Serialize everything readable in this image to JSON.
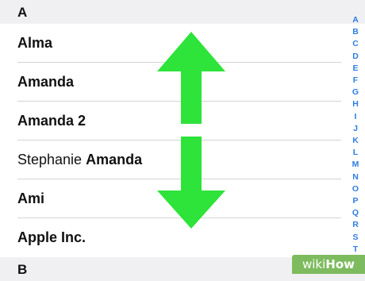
{
  "sections": {
    "a": "A",
    "b": "B"
  },
  "contacts": [
    {
      "first": "",
      "last": "Alma"
    },
    {
      "first": "",
      "last": "Amanda"
    },
    {
      "first": "",
      "last": "Amanda 2"
    },
    {
      "first": "Stephanie ",
      "last": "Amanda"
    },
    {
      "first": "",
      "last": "Ami"
    },
    {
      "first": "",
      "last": "Apple Inc."
    }
  ],
  "index": [
    "A",
    "B",
    "C",
    "D",
    "E",
    "F",
    "G",
    "H",
    "I",
    "J",
    "K",
    "L",
    "M",
    "N",
    "O",
    "P",
    "Q",
    "R",
    "S",
    "T"
  ],
  "overlay": {
    "arrow_color": "#2ee33a",
    "arrow_icon": "double-vertical-arrow-icon"
  },
  "watermark": {
    "part1": "wiki",
    "part2": "How"
  },
  "colors": {
    "index_accent": "#2f7de1",
    "section_header_bg": "#f0f0f2"
  }
}
